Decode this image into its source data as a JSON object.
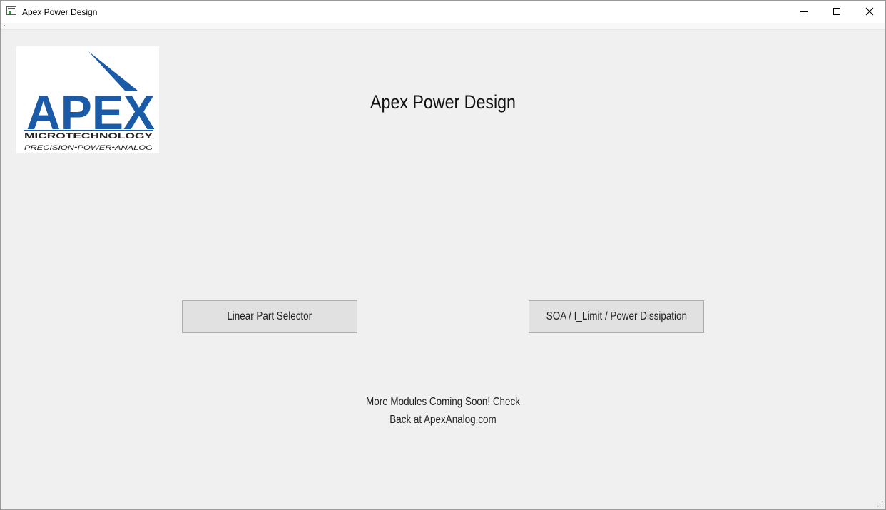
{
  "window": {
    "title": "Apex Power Design"
  },
  "logo": {
    "wordmark": "APEX",
    "subtitle": "MICROTECHNOLOGY",
    "tagline": "PRECISION•POWER•ANALOG",
    "brand_color": "#1a5aa6"
  },
  "main": {
    "heading": "Apex Power Design",
    "buttons": {
      "linear_label": "Linear Part Selector",
      "soa_label": "SOA / I_Limit / Power Dissipation"
    },
    "message_line1": "More Modules Coming Soon! Check",
    "message_line2": "Back at ApexAnalog.com"
  },
  "icons": {
    "app": "app-window-icon",
    "minimize": "minimize-icon",
    "maximize": "maximize-icon",
    "close": "close-icon"
  }
}
